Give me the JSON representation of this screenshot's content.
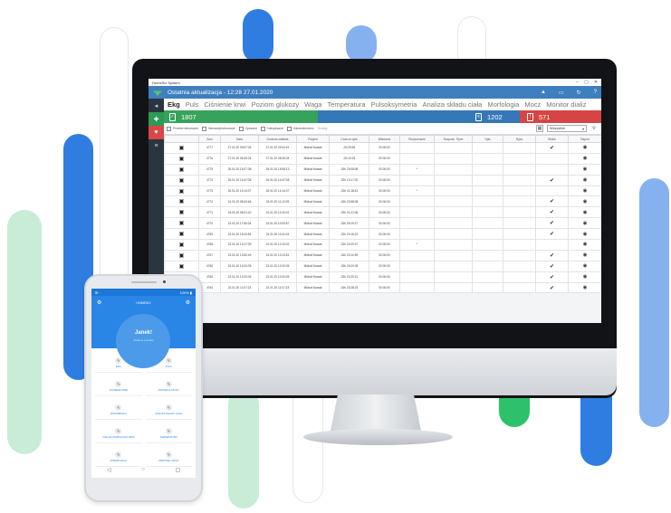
{
  "colors": {
    "blue_pill": "#2f7de1",
    "light_blue_pill": "#86b1ef",
    "green_pill": "#bfe6cf",
    "green_accent": "#2ec16b"
  },
  "window": {
    "title": "HomeSix System",
    "controls": [
      "–",
      "▢",
      "✕"
    ]
  },
  "header": {
    "last_update": "Ostatnia aktualizacja - 12:28 27.01.2020",
    "icons": [
      "notification-icon",
      "device-icon",
      "refresh-icon",
      "help-icon"
    ],
    "icon_glyphs": [
      "▲",
      "▭",
      "↻",
      "?"
    ]
  },
  "sidebar": {
    "items": [
      {
        "name": "dashboard",
        "glyph": "◂"
      },
      {
        "name": "ekg",
        "glyph": "✚"
      },
      {
        "name": "heart",
        "glyph": "♥"
      },
      {
        "name": "list",
        "glyph": "≡"
      }
    ]
  },
  "tabs": [
    "Ekg",
    "Puls",
    "Ciśnienie krwi",
    "Poziom glukozy",
    "Waga",
    "Temperatura",
    "Pulsoksymetria",
    "Analiza składu ciała",
    "Morfologia",
    "Mocz",
    "Monitor dializ"
  ],
  "stats": {
    "green_value": "1807",
    "blue_value": "1202",
    "red_value": "571"
  },
  "filters": {
    "checkboxes": [
      "Przeterminowane",
      "Niezarejestrowane",
      "Opisane",
      "Nieopisane",
      "Nieznaleziono"
    ],
    "search": "Szukaj",
    "select": "Wszystkie"
  },
  "table": {
    "columns": [
      "",
      "Zaru",
      "Data",
      "Godzina ostatnia",
      "Pacjent",
      "Czas na opis",
      "Własność",
      "Rozpoznanie",
      "Rozpozn. Rytm",
      "Opis",
      "Rytm",
      "Widok",
      "Raport"
    ],
    "rows": [
      [
        "4777",
        "27.01.20 09:07:06",
        "27.01.20 09:44:51",
        "Michał Nowak",
        "-00:29:56",
        "00:00:00",
        "",
        "",
        "",
        "",
        "✔",
        "◉"
      ],
      [
        "4776",
        "27.01.20 08:45:34",
        "27.01.20 08:45:34",
        "Michał Nowak",
        "-00:10:26",
        "00:00:00",
        "",
        "",
        "",
        "",
        "",
        "◉"
      ],
      [
        "4775",
        "26.01.20 15:07:38",
        "26.01.20 15:08:13",
        "Michał Nowak",
        "-02h 23:08:08",
        "00:00:00",
        "*",
        "",
        "",
        "",
        "",
        "◉"
      ],
      [
        "4774",
        "26.01.20 14:47:08",
        "26.01.20 14:47:08",
        "Michał Nowak",
        "-02h 13:17:02",
        "00:00:00",
        "",
        "",
        "",
        "",
        "✔",
        "◉"
      ],
      [
        "4773",
        "26.01.20 14:14:07",
        "26.01.20 14:14:07",
        "Michał Nowak",
        "-02h 11:18:43",
        "00:00:00",
        "*",
        "",
        "",
        "",
        "",
        "◉"
      ],
      [
        "4772",
        "24.01.20 08:43:46",
        "24.01.20 11:12:09",
        "Michał Nowak",
        "-02h 20:58:08",
        "00:00:00",
        "",
        "",
        "",
        "",
        "✔",
        "◉"
      ],
      [
        "4771",
        "24.01.20 08:21:20",
        "24.01.20 10:10:01",
        "Michał Nowak",
        "-02h 21:21:06",
        "00:00:00",
        "",
        "",
        "",
        "",
        "✔",
        "◉"
      ],
      [
        "4770",
        "23.01.20 17:50:04",
        "24.01.20 10:09:57",
        "Michał Nowak",
        "-02h 09:19:27",
        "00:00:00",
        "",
        "",
        "",
        "",
        "✔",
        "◉"
      ],
      [
        "4769",
        "23.01.20 15:43:54",
        "24.01.20 10:11:04",
        "Michał Nowak",
        "-02h 20:16:22",
        "00:00:00",
        "",
        "",
        "",
        "",
        "✔",
        "◉"
      ],
      [
        "4768",
        "23.01.20 13:17:39",
        "24.01.20 10:13:02",
        "Michał Nowak",
        "-02h 20:20:07",
        "00:00:00",
        "*",
        "",
        "",
        "",
        "",
        "◉"
      ],
      [
        "4767",
        "23.01.20 10:52:49",
        "24.01.20 10:13:51",
        "Michał Nowak",
        "-02h 20:10:59",
        "00:00:00",
        "",
        "",
        "",
        "",
        "✔",
        "◉"
      ],
      [
        "4766",
        "23.01.20 10:20:05",
        "23.01.20 10:20:05",
        "Michał Nowak",
        "-02h 20:20:05",
        "00:00:00",
        "",
        "",
        "",
        "",
        "✔",
        "◉"
      ],
      [
        "4765",
        "23.01.20 10:20:05",
        "23.01.20 10:20:05",
        "Michał Nowak",
        "-02h 20:20:21",
        "00:00:00",
        "",
        "",
        "",
        "",
        "✔",
        "◉"
      ],
      [
        "4764",
        "22.01.20 11:07:23",
        "22.01.20 11:07:23",
        "Michał Nowak",
        "-02h 23:28:23",
        "00:00:00",
        "",
        "",
        "",
        "",
        "✔",
        "◉"
      ]
    ]
  },
  "phone": {
    "status_left": "✉ ·",
    "status_right": "100% ▮",
    "title": "HOMESIX",
    "name": "Janek!",
    "subtitle": "Ostatnie pomiary",
    "tiles": [
      "EKG",
      "PULS",
      "CIŚNIENIE KRWI",
      "POZIOM GLUKOZY",
      "SPIROMETRIA",
      "ANALIZA SKŁADU CIAŁA",
      "ANALIZA MORFOLOGII KRWI",
      "TEMPERATURA",
      "POMIAR WAGI",
      "ZDROWIE / MOCZ"
    ],
    "nav": [
      "◁",
      "○",
      "▢"
    ]
  }
}
